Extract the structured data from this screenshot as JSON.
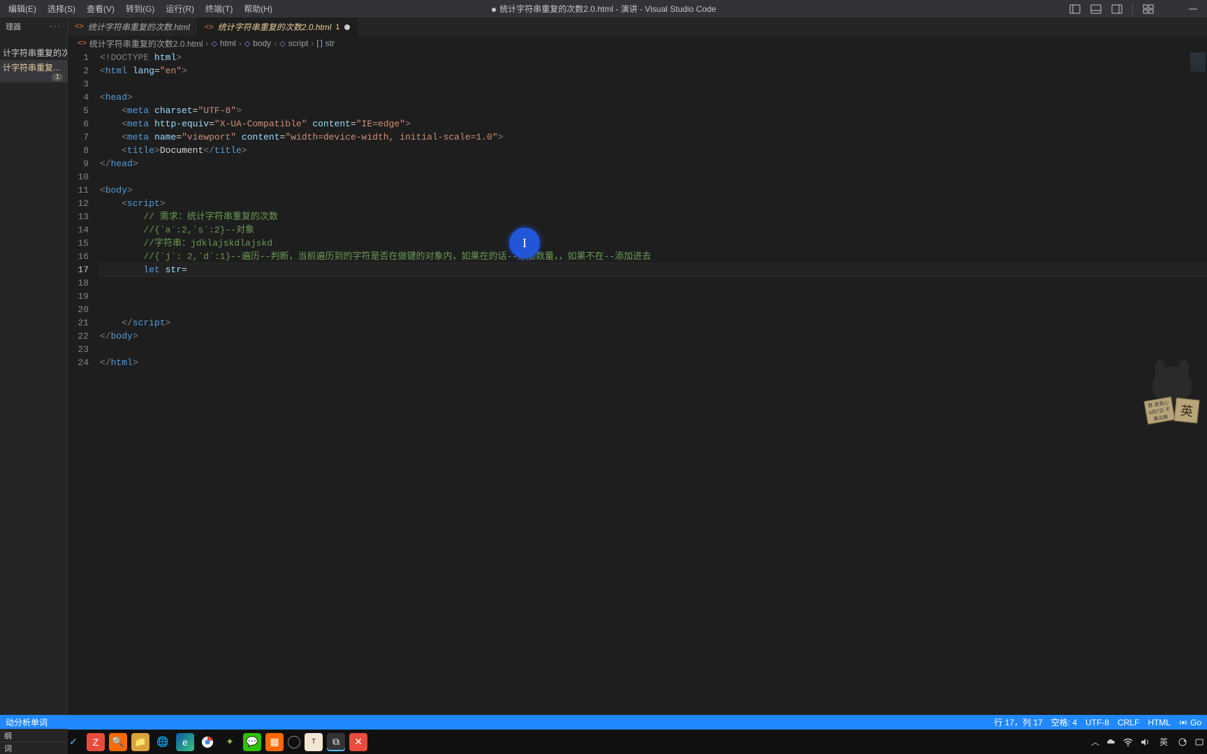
{
  "window": {
    "title_prefix": "●",
    "title": "统计字符串重复的次数2.0.html - 演讲 - Visual Studio Code"
  },
  "menu": {
    "items": [
      "编辑(E)",
      "选择(S)",
      "查看(V)",
      "转到(G)",
      "运行(R)",
      "终端(T)",
      "帮助(H)"
    ]
  },
  "sidebar": {
    "header": "理器",
    "files": [
      {
        "label": "计字符串重复的次...",
        "active": false
      },
      {
        "label": "计字符串重复...",
        "badge": "1",
        "active": true
      }
    ],
    "sections": [
      "纲",
      "词",
      "动分析单词"
    ]
  },
  "tabs": [
    {
      "label": "统计字符串重复的次数.html",
      "active": false,
      "dirty": false
    },
    {
      "label": "统计字符串重复的次数2.0.html",
      "active": true,
      "dirty": true,
      "errors": "1"
    }
  ],
  "breadcrumbs": [
    {
      "icon": "file",
      "label": "统计字符串重复的次数2.0.html"
    },
    {
      "icon": "cube",
      "label": "html"
    },
    {
      "icon": "cube",
      "label": "body"
    },
    {
      "icon": "cube",
      "label": "script"
    },
    {
      "icon": "var",
      "label": "str"
    }
  ],
  "code": {
    "current_line": 17,
    "lines": [
      {
        "n": 1,
        "html": "<span class='t-angle'>&lt;</span><span class='t-doctype'>!DOCTYPE</span> <span class='t-attr'>html</span><span class='t-angle'>&gt;</span>"
      },
      {
        "n": 2,
        "html": "<span class='t-angle'>&lt;</span><span class='t-tag'>html</span> <span class='t-attr'>lang</span><span class='t-eq'>=</span><span class='t-str'>\"en\"</span><span class='t-angle'>&gt;</span>"
      },
      {
        "n": 3,
        "html": ""
      },
      {
        "n": 4,
        "html": "<span class='t-angle'>&lt;</span><span class='t-tag'>head</span><span class='t-angle'>&gt;</span>"
      },
      {
        "n": 5,
        "html": "    <span class='t-angle'>&lt;</span><span class='t-tag'>meta</span> <span class='t-attr'>charset</span><span class='t-eq'>=</span><span class='t-str'>\"UTF-8\"</span><span class='t-angle'>&gt;</span>"
      },
      {
        "n": 6,
        "html": "    <span class='t-angle'>&lt;</span><span class='t-tag'>meta</span> <span class='t-attr'>http-equiv</span><span class='t-eq'>=</span><span class='t-str'>\"X-UA-Compatible\"</span> <span class='t-attr'>content</span><span class='t-eq'>=</span><span class='t-str'>\"IE=edge\"</span><span class='t-angle'>&gt;</span>"
      },
      {
        "n": 7,
        "html": "    <span class='t-angle'>&lt;</span><span class='t-tag'>meta</span> <span class='t-attr'>name</span><span class='t-eq'>=</span><span class='t-str'>\"viewport\"</span> <span class='t-attr'>content</span><span class='t-eq'>=</span><span class='t-str'>\"width=device-width, initial-scale=1.0\"</span><span class='t-angle'>&gt;</span>"
      },
      {
        "n": 8,
        "html": "    <span class='t-angle'>&lt;</span><span class='t-tag'>title</span><span class='t-angle'>&gt;</span><span class='t-text'>Document</span><span class='t-angle'>&lt;/</span><span class='t-tag'>title</span><span class='t-angle'>&gt;</span>"
      },
      {
        "n": 9,
        "html": "<span class='t-angle'>&lt;/</span><span class='t-tag'>head</span><span class='t-angle'>&gt;</span>"
      },
      {
        "n": 10,
        "html": ""
      },
      {
        "n": 11,
        "html": "<span class='t-angle'>&lt;</span><span class='t-tag'>body</span><span class='t-angle'>&gt;</span>"
      },
      {
        "n": 12,
        "html": "    <span class='t-angle'>&lt;</span><span class='t-tag'>script</span><span class='t-angle'>&gt;</span>"
      },
      {
        "n": 13,
        "html": "        <span class='t-comment'>// 需求：统计字符串重复的次数</span>"
      },
      {
        "n": 14,
        "html": "        <span class='t-comment'>//{`a`:2,`s`:2}--对象</span>"
      },
      {
        "n": 15,
        "html": "        <span class='t-comment'>//字符串：jdklajskdlajskd</span>"
      },
      {
        "n": 16,
        "html": "        <span class='t-comment'>//{`j`: 2,`d`:1}--遍历--判断，当前遍历到的字符是否在做键的对象内，如果在的话--添加数量，，如果不在--添加进去</span>"
      },
      {
        "n": 17,
        "html": "        <span class='t-kwd'>let</span> <span class='t-var'>str</span><span class='t-eq'>=</span><span style='border-bottom:2px wavy #f14c4c;'> </span>"
      },
      {
        "n": 18,
        "html": ""
      },
      {
        "n": 19,
        "html": ""
      },
      {
        "n": 20,
        "html": ""
      },
      {
        "n": 21,
        "html": "    <span class='t-angle'>&lt;/</span><span class='t-tag'>script</span><span class='t-angle'>&gt;</span>"
      },
      {
        "n": 22,
        "html": "<span class='t-angle'>&lt;/</span><span class='t-tag'>body</span><span class='t-angle'>&gt;</span>"
      },
      {
        "n": 23,
        "html": ""
      },
      {
        "n": 24,
        "html": "<span class='t-angle'>&lt;/</span><span class='t-tag'>html</span><span class='t-angle'>&gt;</span>"
      }
    ]
  },
  "statusbar": {
    "left": "动分析单词",
    "pos": "行 17，列 17",
    "spaces": "空格: 4",
    "encoding": "UTF-8",
    "eol": "CRLF",
    "lang": "HTML",
    "go": "Go"
  },
  "taskbar": {
    "ime": "英",
    "tray_ime": "英"
  },
  "cursor_blob": {
    "glyph": "I"
  },
  "mascot": {
    "card1": "算·是我心\n9月7日 不离远离",
    "card2": "英"
  }
}
